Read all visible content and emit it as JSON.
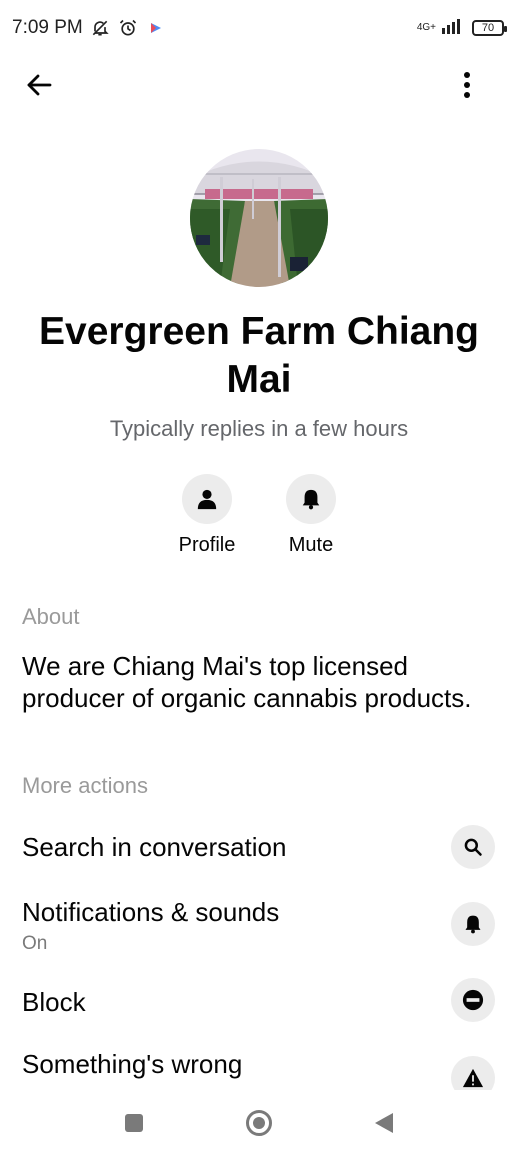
{
  "status_bar": {
    "time": "7:09 PM",
    "network": "4G+",
    "battery": "70",
    "icons": [
      "bell-off-icon",
      "alarm-icon",
      "play-store-icon",
      "signal-icon",
      "battery-icon"
    ]
  },
  "header": {
    "back_icon": "arrow-left-icon",
    "menu_icon": "more-vertical-icon"
  },
  "profile": {
    "name": "Evergreen Farm Chiang Mai",
    "reply_status": "Typically replies in a few hours"
  },
  "quick_actions": [
    {
      "label": "Profile",
      "icon": "person-icon"
    },
    {
      "label": "Mute",
      "icon": "bell-icon"
    }
  ],
  "about": {
    "heading": "About",
    "text": "We are Chiang Mai's top licensed producer of organic cannabis products."
  },
  "more_actions": {
    "heading": "More actions",
    "items": [
      {
        "label": "Search in conversation",
        "icon": "search-icon"
      },
      {
        "label": "Notifications  & sounds",
        "sub": "On",
        "icon": "bell-icon"
      },
      {
        "label": "Block",
        "icon": "block-icon"
      },
      {
        "label": "Something's wrong",
        "icon": "warning-icon"
      }
    ]
  },
  "nav": {
    "icons": [
      "recent-apps-icon",
      "home-icon",
      "back-icon"
    ]
  },
  "colors": {
    "text_primary": "#050505",
    "text_secondary": "#65676b",
    "section_heading": "#9a9a9a",
    "icon_bg": "#ececec"
  }
}
